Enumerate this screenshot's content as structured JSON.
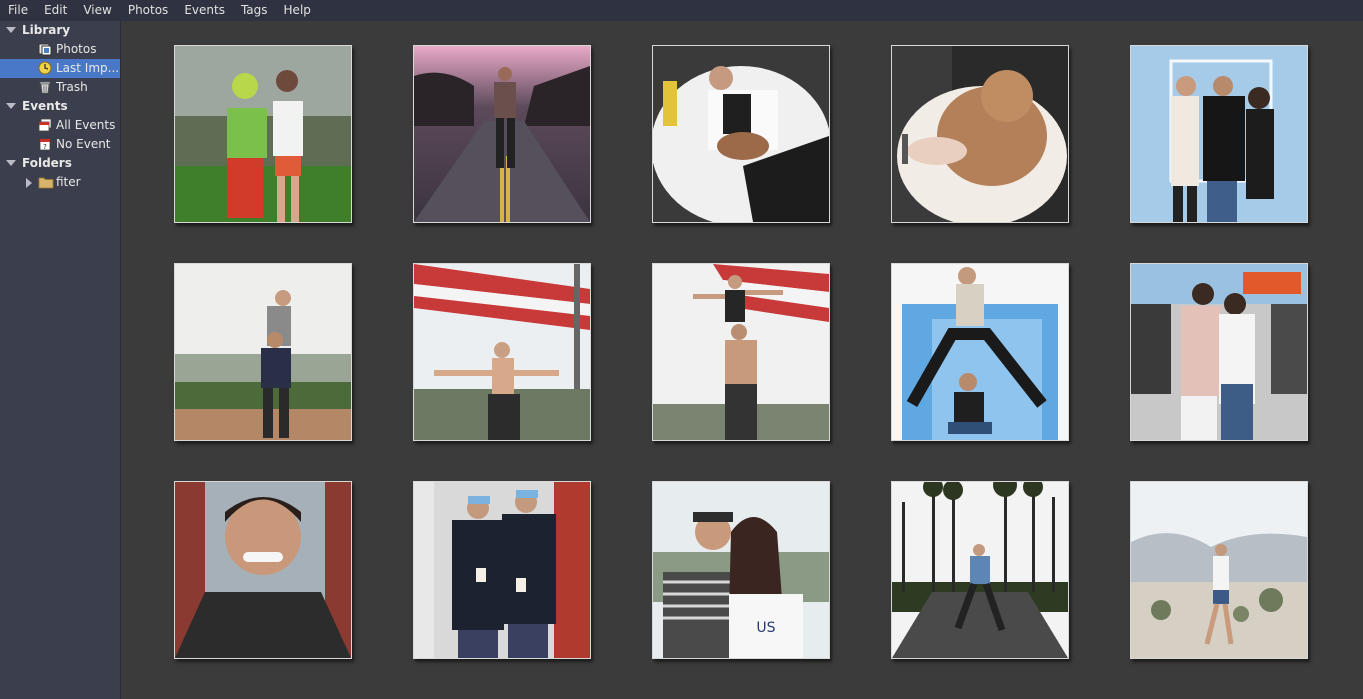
{
  "menu": [
    "File",
    "Edit",
    "View",
    "Photos",
    "Events",
    "Tags",
    "Help"
  ],
  "sidebar": {
    "library": {
      "label": "Library",
      "items": [
        {
          "label": "Photos",
          "icon": "photos-icon"
        },
        {
          "label": "Last Imp...",
          "icon": "last-import-clock-icon",
          "selected": true
        },
        {
          "label": "Trash",
          "icon": "trash-icon"
        }
      ]
    },
    "events": {
      "label": "Events",
      "items": [
        {
          "label": "All Events",
          "icon": "all-events-calendar-icon"
        },
        {
          "label": "No Event",
          "icon": "no-event-calendar-icon"
        }
      ]
    },
    "folders": {
      "label": "Folders",
      "items": [
        {
          "label": "fiter",
          "icon": "folder-icon"
        }
      ]
    }
  },
  "colors": {
    "menubar_bg": "#2f3240",
    "sidebar_bg": "#3b3e4c",
    "selection": "#4a78c8",
    "grid_bg": "#3b3b3b"
  },
  "photo_count": 15
}
